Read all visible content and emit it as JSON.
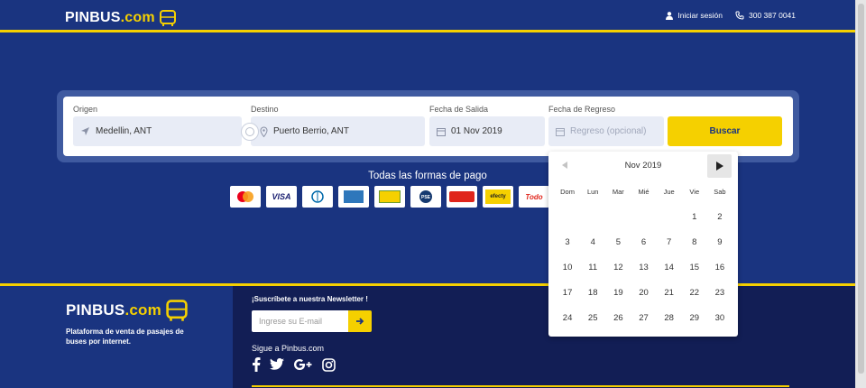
{
  "header": {
    "logo_main": "PINBUS",
    "logo_com": ".com",
    "login_label": "Iniciar sesión",
    "phone": "300 387 0041"
  },
  "search": {
    "origin_label": "Origen",
    "origin_value": "Medellin, ANT",
    "destination_label": "Destino",
    "destination_value": "Puerto Berrio, ANT",
    "departure_label": "Fecha de Salida",
    "departure_value": "01 Nov 2019",
    "return_label": "Fecha de Regreso",
    "return_placeholder": "Regreso (opcional)",
    "search_button": "Buscar"
  },
  "payments": {
    "title": "Todas las formas de pago",
    "methods": [
      "Mastercard",
      "VISA",
      "Diners Club",
      "American Express",
      "Baloto",
      "PSE",
      "Baloto",
      "efecty",
      "Todo"
    ]
  },
  "calendar": {
    "month_label": "Nov 2019",
    "weekdays": [
      "Dom",
      "Lun",
      "Mar",
      "Mié",
      "Jue",
      "Vie",
      "Sab"
    ],
    "weeks": [
      [
        "",
        "",
        "",
        "",
        "",
        "1",
        "2"
      ],
      [
        "3",
        "4",
        "5",
        "6",
        "7",
        "8",
        "9"
      ],
      [
        "10",
        "11",
        "12",
        "13",
        "14",
        "15",
        "16"
      ],
      [
        "17",
        "18",
        "19",
        "20",
        "21",
        "22",
        "23"
      ],
      [
        "24",
        "25",
        "26",
        "27",
        "28",
        "29",
        "30"
      ]
    ]
  },
  "footer": {
    "logo_main": "PINBUS",
    "logo_com": ".com",
    "tagline": "Plataforma de venta de pasajes de buses por internet.",
    "newsletter_title": "¡Suscríbete a nuestra Newsletter !",
    "newsletter_placeholder": "Ingrese su E-mail",
    "follow_title": "Sigue a Pinbus.com",
    "socials": [
      "facebook-icon",
      "twitter-icon",
      "google-plus-icon",
      "instagram-icon"
    ]
  },
  "colors": {
    "primary": "#1a3480",
    "accent": "#f5d000",
    "footer_dark": "#121e55"
  }
}
